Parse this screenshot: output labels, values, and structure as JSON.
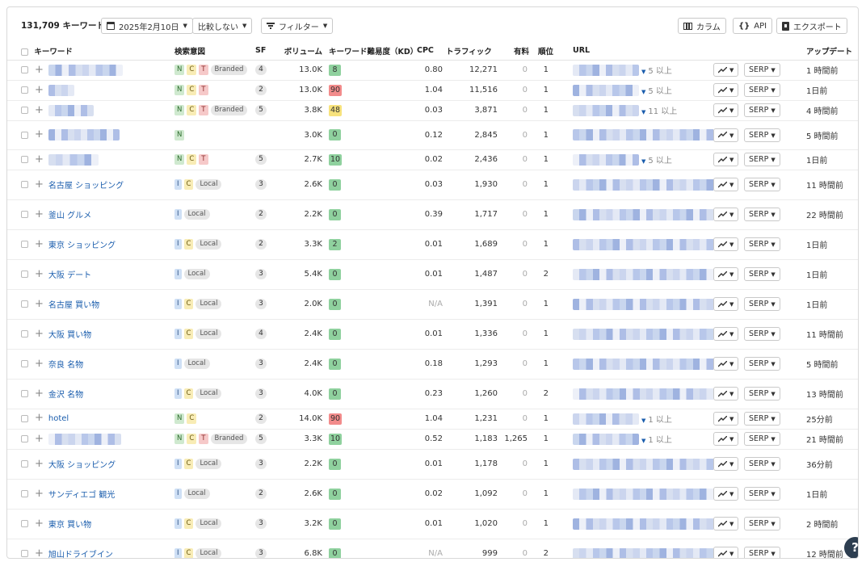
{
  "toolbar": {
    "count": "131,709 キーワード",
    "date": "2025年2月10日",
    "compare": "比較しない",
    "filter": "フィルター",
    "columns": "カラム",
    "api": "API",
    "export": "エクスポート"
  },
  "columns": {
    "keyword": "キーワード",
    "intent": "検索意図",
    "sf": "SF",
    "volume": "ボリューム",
    "kd": "キーワード難易度（KD）",
    "cpc": "CPC",
    "traffic": "トラフィック",
    "paid": "有料",
    "position": "順位",
    "url": "URL",
    "updated": "アップデート"
  },
  "colors": {
    "kd_easy": "#8fd19e",
    "kd_mid": "#f7e27c",
    "kd_hard": "#f28b8b",
    "link": "#1a5dad",
    "help_bg": "#2d3e50"
  },
  "serp_label": "SERP",
  "rows": [
    {
      "keyword": "",
      "blurred": true,
      "intents": [
        "N",
        "C",
        "T",
        "Branded"
      ],
      "sf": "4",
      "volume": "13.0K",
      "kd": "8",
      "kd_level": "easy",
      "cpc": "0.80",
      "traffic": "12,271",
      "paid": "0",
      "position": "1",
      "url_more": "5 以上",
      "updated": "1 時間前"
    },
    {
      "keyword": "",
      "blurred": true,
      "intents": [
        "N",
        "C",
        "T"
      ],
      "sf": "2",
      "volume": "13.0K",
      "kd": "90",
      "kd_level": "hard",
      "cpc": "1.04",
      "traffic": "11,516",
      "paid": "0",
      "position": "1",
      "url_more": "5 以上",
      "updated": "1日前"
    },
    {
      "keyword": "",
      "blurred": true,
      "intents": [
        "N",
        "C",
        "T",
        "Branded"
      ],
      "sf": "5",
      "volume": "3.8K",
      "kd": "48",
      "kd_level": "mid",
      "cpc": "0.03",
      "traffic": "3,871",
      "paid": "0",
      "position": "1",
      "url_more": "11 以上",
      "updated": "4 時間前"
    },
    {
      "keyword": "",
      "blurred": true,
      "intents": [
        "N"
      ],
      "sf": "",
      "volume": "3.0K",
      "kd": "0",
      "kd_level": "easy",
      "cpc": "0.12",
      "traffic": "2,845",
      "paid": "0",
      "position": "1",
      "url_more": "",
      "updated": "5 時間前"
    },
    {
      "keyword": "",
      "blurred": true,
      "intents": [
        "N",
        "C",
        "T"
      ],
      "sf": "5",
      "volume": "2.7K",
      "kd": "10",
      "kd_level": "easy",
      "cpc": "0.02",
      "traffic": "2,436",
      "paid": "0",
      "position": "1",
      "url_more": "5 以上",
      "updated": "1日前"
    },
    {
      "keyword": "名古屋 ショッピング",
      "blurred": false,
      "intents": [
        "I",
        "C",
        "Local"
      ],
      "sf": "3",
      "volume": "2.6K",
      "kd": "0",
      "kd_level": "easy",
      "cpc": "0.03",
      "traffic": "1,930",
      "paid": "0",
      "position": "1",
      "url_more": "",
      "updated": "11 時間前"
    },
    {
      "keyword": "釜山 グルメ",
      "blurred": false,
      "intents": [
        "I",
        "Local"
      ],
      "sf": "2",
      "volume": "2.2K",
      "kd": "0",
      "kd_level": "easy",
      "cpc": "0.39",
      "traffic": "1,717",
      "paid": "0",
      "position": "1",
      "url_more": "",
      "updated": "22 時間前"
    },
    {
      "keyword": "東京 ショッピング",
      "blurred": false,
      "intents": [
        "I",
        "C",
        "Local"
      ],
      "sf": "2",
      "volume": "3.3K",
      "kd": "2",
      "kd_level": "easy",
      "cpc": "0.01",
      "traffic": "1,689",
      "paid": "0",
      "position": "1",
      "url_more": "",
      "updated": "1日前"
    },
    {
      "keyword": "大阪 デート",
      "blurred": false,
      "intents": [
        "I",
        "Local"
      ],
      "sf": "3",
      "volume": "5.4K",
      "kd": "0",
      "kd_level": "easy",
      "cpc": "0.01",
      "traffic": "1,487",
      "paid": "0",
      "position": "2",
      "url_more": "",
      "updated": "1日前"
    },
    {
      "keyword": "名古屋 買い物",
      "blurred": false,
      "intents": [
        "I",
        "C",
        "Local"
      ],
      "sf": "3",
      "volume": "2.0K",
      "kd": "0",
      "kd_level": "easy",
      "cpc": "N/A",
      "traffic": "1,391",
      "paid": "0",
      "position": "1",
      "url_more": "",
      "updated": "1日前"
    },
    {
      "keyword": "大阪 買い物",
      "blurred": false,
      "intents": [
        "I",
        "C",
        "Local"
      ],
      "sf": "4",
      "volume": "2.4K",
      "kd": "0",
      "kd_level": "easy",
      "cpc": "0.01",
      "traffic": "1,336",
      "paid": "0",
      "position": "1",
      "url_more": "",
      "updated": "11 時間前"
    },
    {
      "keyword": "奈良 名物",
      "blurred": false,
      "intents": [
        "I",
        "Local"
      ],
      "sf": "3",
      "volume": "2.4K",
      "kd": "0",
      "kd_level": "easy",
      "cpc": "0.18",
      "traffic": "1,293",
      "paid": "0",
      "position": "1",
      "url_more": "",
      "updated": "5 時間前"
    },
    {
      "keyword": "金沢 名物",
      "blurred": false,
      "intents": [
        "I",
        "C",
        "Local"
      ],
      "sf": "3",
      "volume": "4.0K",
      "kd": "0",
      "kd_level": "easy",
      "cpc": "0.23",
      "traffic": "1,260",
      "paid": "0",
      "position": "2",
      "url_more": "",
      "updated": "13 時間前"
    },
    {
      "keyword": "hotel",
      "blurred": false,
      "intents": [
        "N",
        "C"
      ],
      "sf": "2",
      "volume": "14.0K",
      "kd": "90",
      "kd_level": "hard",
      "cpc": "1.04",
      "traffic": "1,231",
      "paid": "0",
      "position": "1",
      "url_more": "1 以上",
      "updated": "25分前"
    },
    {
      "keyword": "",
      "blurred": true,
      "intents": [
        "N",
        "C",
        "T",
        "Branded"
      ],
      "sf": "5",
      "volume": "3.3K",
      "kd": "10",
      "kd_level": "easy",
      "cpc": "0.52",
      "traffic": "1,183",
      "paid": "1,265",
      "position": "1",
      "url_more": "1 以上",
      "updated": "21 時間前"
    },
    {
      "keyword": "大阪 ショッピング",
      "blurred": false,
      "intents": [
        "I",
        "C",
        "Local"
      ],
      "sf": "3",
      "volume": "2.2K",
      "kd": "0",
      "kd_level": "easy",
      "cpc": "0.01",
      "traffic": "1,178",
      "paid": "0",
      "position": "1",
      "url_more": "",
      "updated": "36分前"
    },
    {
      "keyword": "サンディエゴ 観光",
      "blurred": false,
      "intents": [
        "I",
        "Local"
      ],
      "sf": "2",
      "volume": "2.6K",
      "kd": "0",
      "kd_level": "easy",
      "cpc": "0.02",
      "traffic": "1,092",
      "paid": "0",
      "position": "1",
      "url_more": "",
      "updated": "1日前"
    },
    {
      "keyword": "東京 買い物",
      "blurred": false,
      "intents": [
        "I",
        "C",
        "Local"
      ],
      "sf": "3",
      "volume": "3.2K",
      "kd": "0",
      "kd_level": "easy",
      "cpc": "0.01",
      "traffic": "1,020",
      "paid": "0",
      "position": "1",
      "url_more": "",
      "updated": "2 時間前"
    },
    {
      "keyword": "旭山ドライブイン",
      "blurred": false,
      "intents": [
        "I",
        "C",
        "Local"
      ],
      "sf": "3",
      "volume": "6.8K",
      "kd": "0",
      "kd_level": "easy",
      "cpc": "N/A",
      "traffic": "999",
      "paid": "0",
      "position": "2",
      "url_more": "",
      "updated": "12 時間前"
    }
  ],
  "help": "?"
}
